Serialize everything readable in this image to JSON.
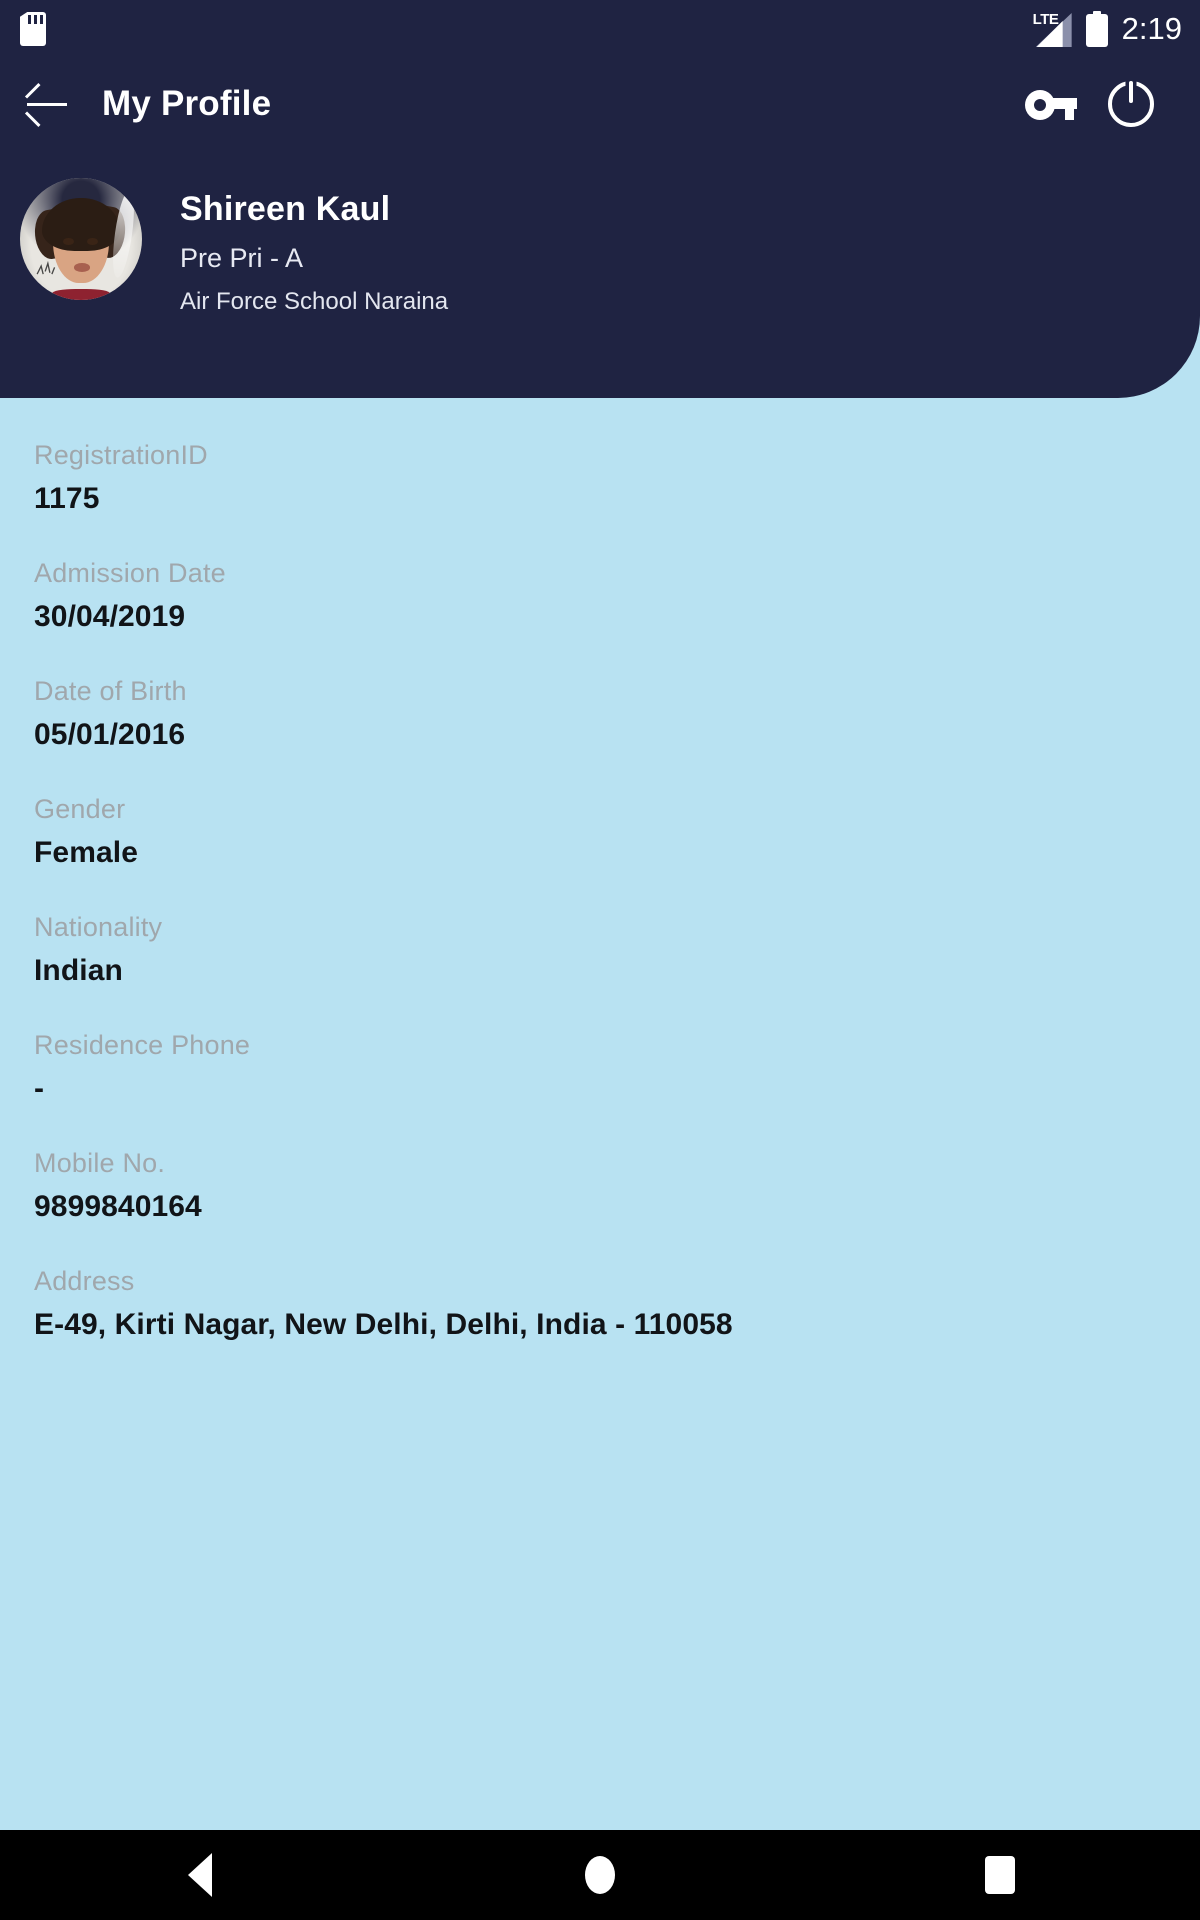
{
  "status_bar": {
    "sd_card_icon": "sd-card-icon",
    "network_label": "LTE",
    "signal_icon": "signal-bars-icon",
    "battery_icon": "battery-full-icon",
    "time": "2:19"
  },
  "app_bar": {
    "back_icon": "back-arrow-icon",
    "title": "My Profile",
    "key_icon": "key-icon",
    "key_label": "Change Password",
    "power_icon": "power-icon",
    "power_label": "Logout"
  },
  "profile": {
    "avatar_icon": "avatar",
    "name": "Shireen Kaul",
    "class": "Pre Pri - A",
    "school": "Air Force School Naraina"
  },
  "details": [
    {
      "label": "RegistrationID",
      "value": "1175"
    },
    {
      "label": "Admission Date",
      "value": "30/04/2019"
    },
    {
      "label": "Date of Birth",
      "value": "05/01/2016"
    },
    {
      "label": "Gender",
      "value": "Female"
    },
    {
      "label": "Nationality",
      "value": "Indian"
    },
    {
      "label": "Residence Phone",
      "value": "-"
    },
    {
      "label": "Mobile No.",
      "value": "9899840164"
    },
    {
      "label": "Address",
      "value": "E-49, Kirti Nagar, New Delhi, Delhi, India - 110058"
    }
  ],
  "nav_bar": {
    "back_icon": "nav-back-icon",
    "home_icon": "nav-home-icon",
    "recents_icon": "nav-recents-icon"
  },
  "colors": {
    "header_navy": "#1f2342",
    "page_background": "#b8e2f2",
    "label_gray": "#a0a7ac",
    "value_dark": "#111418",
    "nav_bar_black": "#000000"
  }
}
